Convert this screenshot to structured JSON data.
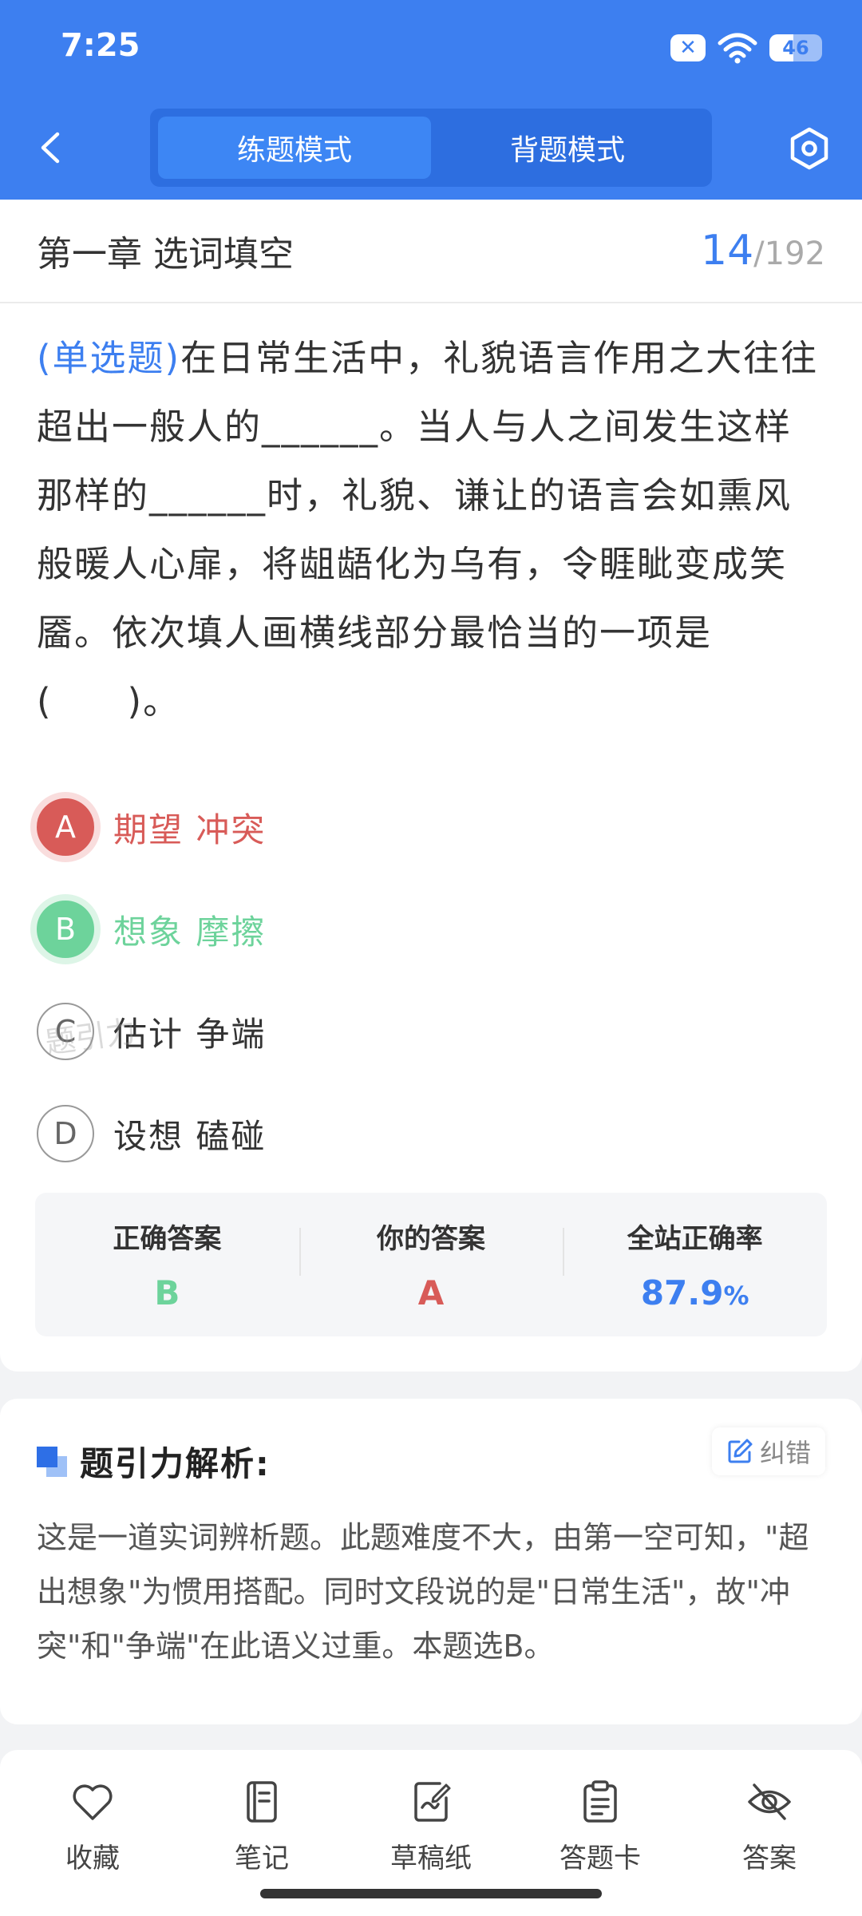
{
  "status_bar": {
    "time": "7:25",
    "battery": "46",
    "battery_level": 0.46
  },
  "header": {
    "modes": [
      {
        "label": "练题模式",
        "active": true
      },
      {
        "label": "背题模式",
        "active": false
      }
    ]
  },
  "chapter": {
    "title": "第一章 选词填空",
    "current": "14",
    "separator": "/",
    "total": "192"
  },
  "question": {
    "type": "(单选题)",
    "text": "在日常生活中，礼貌语言作用之大往往超出一般人的______。当人与人之间发生这样那样的______时，礼貌、谦让的语言会如熏风般暖人心扉，将龃龉化为乌有，令睚眦变成笑靥。依次填人画横线部分最恰当的一项是(　　)。"
  },
  "options": [
    {
      "letter": "A",
      "text": "期望 冲突",
      "state": "wrong"
    },
    {
      "letter": "B",
      "text": "想象 摩擦",
      "state": "right"
    },
    {
      "letter": "C",
      "text": "估计 争端",
      "state": "none"
    },
    {
      "letter": "D",
      "text": "设想 磕碰",
      "state": "none"
    }
  ],
  "watermark": "题引力",
  "summary": {
    "correct_label": "正确答案",
    "correct_value": "B",
    "yours_label": "你的答案",
    "yours_value": "A",
    "rate_label": "全站正确率",
    "rate_value": "87.9",
    "rate_unit": "%"
  },
  "analysis": {
    "title": "题引力解析:",
    "correction_label": "纠错",
    "body": "这是一道实词辨析题。此题难度不大，由第一空可知，\"超出想象\"为惯用搭配。同时文段说的是\"日常生活\"，故\"冲突\"和\"争端\"在此语义过重。本题选B。"
  },
  "toolbar": {
    "items": [
      {
        "label": "收藏",
        "icon": "heart-icon"
      },
      {
        "label": "笔记",
        "icon": "notebook-icon"
      },
      {
        "label": "草稿纸",
        "icon": "draft-icon"
      },
      {
        "label": "答题卡",
        "icon": "clipboard-icon"
      },
      {
        "label": "答案",
        "icon": "eye-off-icon"
      }
    ]
  },
  "colors": {
    "primary": "#3d7ff0",
    "wrong": "#d85b58",
    "right": "#6dd39b"
  }
}
